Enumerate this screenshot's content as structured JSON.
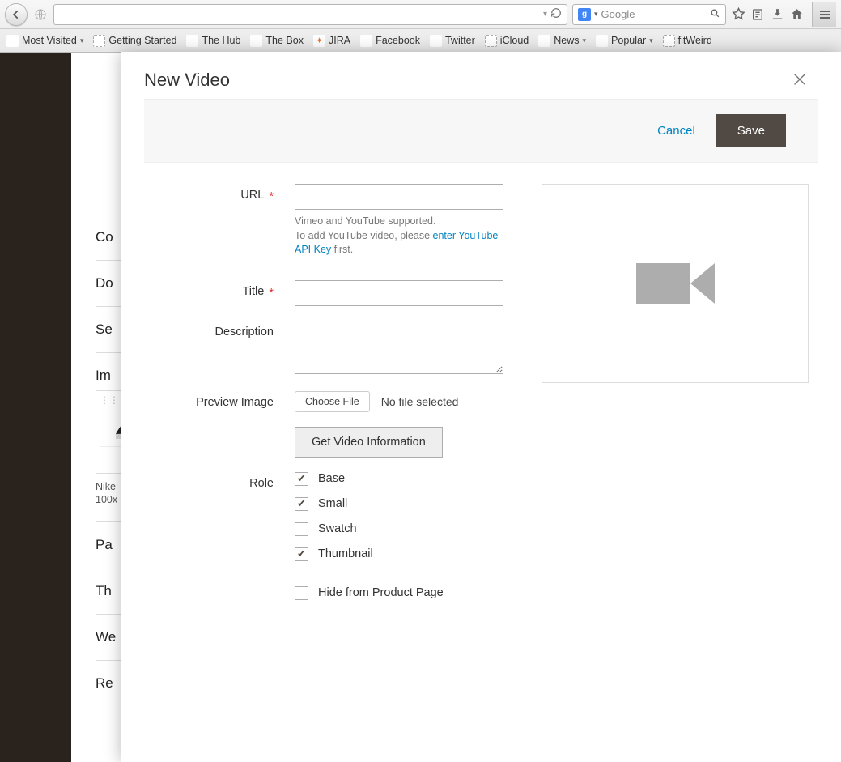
{
  "browser": {
    "search_placeholder": "Google",
    "bookmarks": [
      {
        "label": "Most Visited",
        "fav_class": "solid fav-mv",
        "icon": "◉",
        "dropdown": true
      },
      {
        "label": "Getting Started",
        "fav_class": "",
        "icon": "",
        "dropdown": false
      },
      {
        "label": "The Hub",
        "fav_class": "solid fav-hub",
        "icon": "⬡",
        "dropdown": false
      },
      {
        "label": "The Box",
        "fav_class": "solid fav-box",
        "icon": "b",
        "dropdown": false
      },
      {
        "label": "JIRA",
        "fav_class": "solid fav-jira",
        "icon": "✦",
        "dropdown": false
      },
      {
        "label": "Facebook",
        "fav_class": "solid fav-fb",
        "icon": "f",
        "dropdown": false
      },
      {
        "label": "Twitter",
        "fav_class": "solid fav-tw",
        "icon": "✦",
        "dropdown": false
      },
      {
        "label": "iCloud",
        "fav_class": "",
        "icon": "",
        "dropdown": false
      },
      {
        "label": "News",
        "fav_class": "solid fav-folder",
        "icon": "▣",
        "dropdown": true
      },
      {
        "label": "Popular",
        "fav_class": "solid fav-folder",
        "icon": "▣",
        "dropdown": true
      },
      {
        "label": "fitWeird",
        "fav_class": "",
        "icon": "",
        "dropdown": false
      }
    ]
  },
  "bg_page": {
    "sections": [
      "Co",
      "Do",
      "Se",
      "Im",
      "Pa",
      "Th",
      "We",
      "Re"
    ],
    "img_tile": {
      "caption_line1": "Nike ",
      "caption_line2": "100x"
    }
  },
  "modal": {
    "title": "New Video",
    "actions": {
      "cancel": "Cancel",
      "save": "Save"
    },
    "labels": {
      "url": "URL",
      "title": "Title",
      "description": "Description",
      "preview_image": "Preview Image",
      "role": "Role"
    },
    "url_help": {
      "line1": "Vimeo and YouTube supported.",
      "line2a": "To add YouTube video, please ",
      "link": "enter YouTube API Key",
      "line2b": " first."
    },
    "file": {
      "choose": "Choose File",
      "no_file": "No file selected"
    },
    "get_info": "Get Video Information",
    "roles": [
      {
        "label": "Base",
        "checked": true
      },
      {
        "label": "Small",
        "checked": true
      },
      {
        "label": "Swatch",
        "checked": false
      },
      {
        "label": "Thumbnail",
        "checked": true
      }
    ],
    "hide_label": "Hide from Product Page",
    "hide_checked": false
  }
}
